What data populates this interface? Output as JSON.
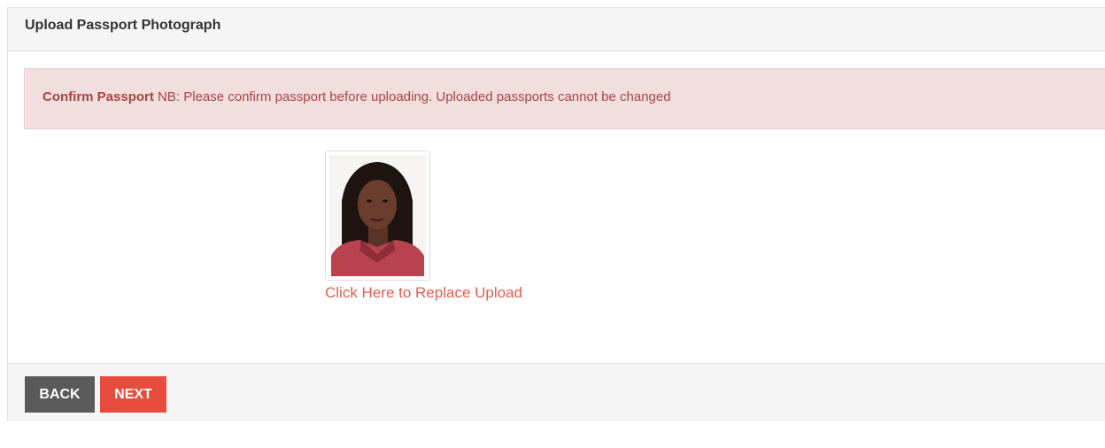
{
  "header": {
    "title": "Upload Passport Photograph"
  },
  "alert": {
    "strong": "Confirm Passport",
    "message": " NB: Please confirm passport before uploading. Uploaded passports cannot be changed"
  },
  "upload": {
    "photo_icon": "passport-photo",
    "replace_link": "Click Here to Replace Upload"
  },
  "footer": {
    "back_label": "BACK",
    "next_label": "NEXT"
  },
  "colors": {
    "alert_bg": "#f2dede",
    "alert_text": "#a94442",
    "link": "#e05e4f",
    "back_button": "#5a5a5a",
    "next_button": "#e74c3c"
  }
}
